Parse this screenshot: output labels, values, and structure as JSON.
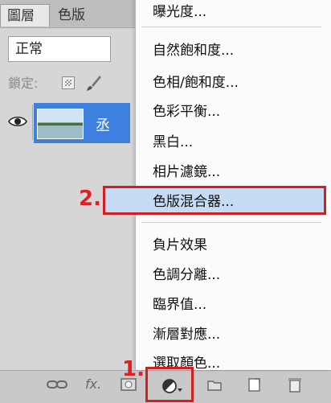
{
  "layers_panel": {
    "tab_layers": "圖層",
    "tab_channels": "色版",
    "blend_mode": "正常",
    "lock_label": "鎖定:",
    "layer_name_partial": "丞"
  },
  "bottom_bar": {
    "fx_label": "fx."
  },
  "adjustment_menu": {
    "items": [
      "曝光度...",
      "自然飽和度...",
      "色相/飽和度...",
      "色彩平衡...",
      "黑白...",
      "相片濾鏡...",
      "色版混合器...",
      "負片效果",
      "色調分離...",
      "臨界值...",
      "漸層對應...",
      "選取顏色..."
    ],
    "highlighted_index": 6
  },
  "annotations": {
    "step1": "1.",
    "step2": "2."
  },
  "colors": {
    "highlight_fill": "#c6dcf4",
    "annotation_red": "#d02020",
    "layer_selected": "#3d80df"
  }
}
